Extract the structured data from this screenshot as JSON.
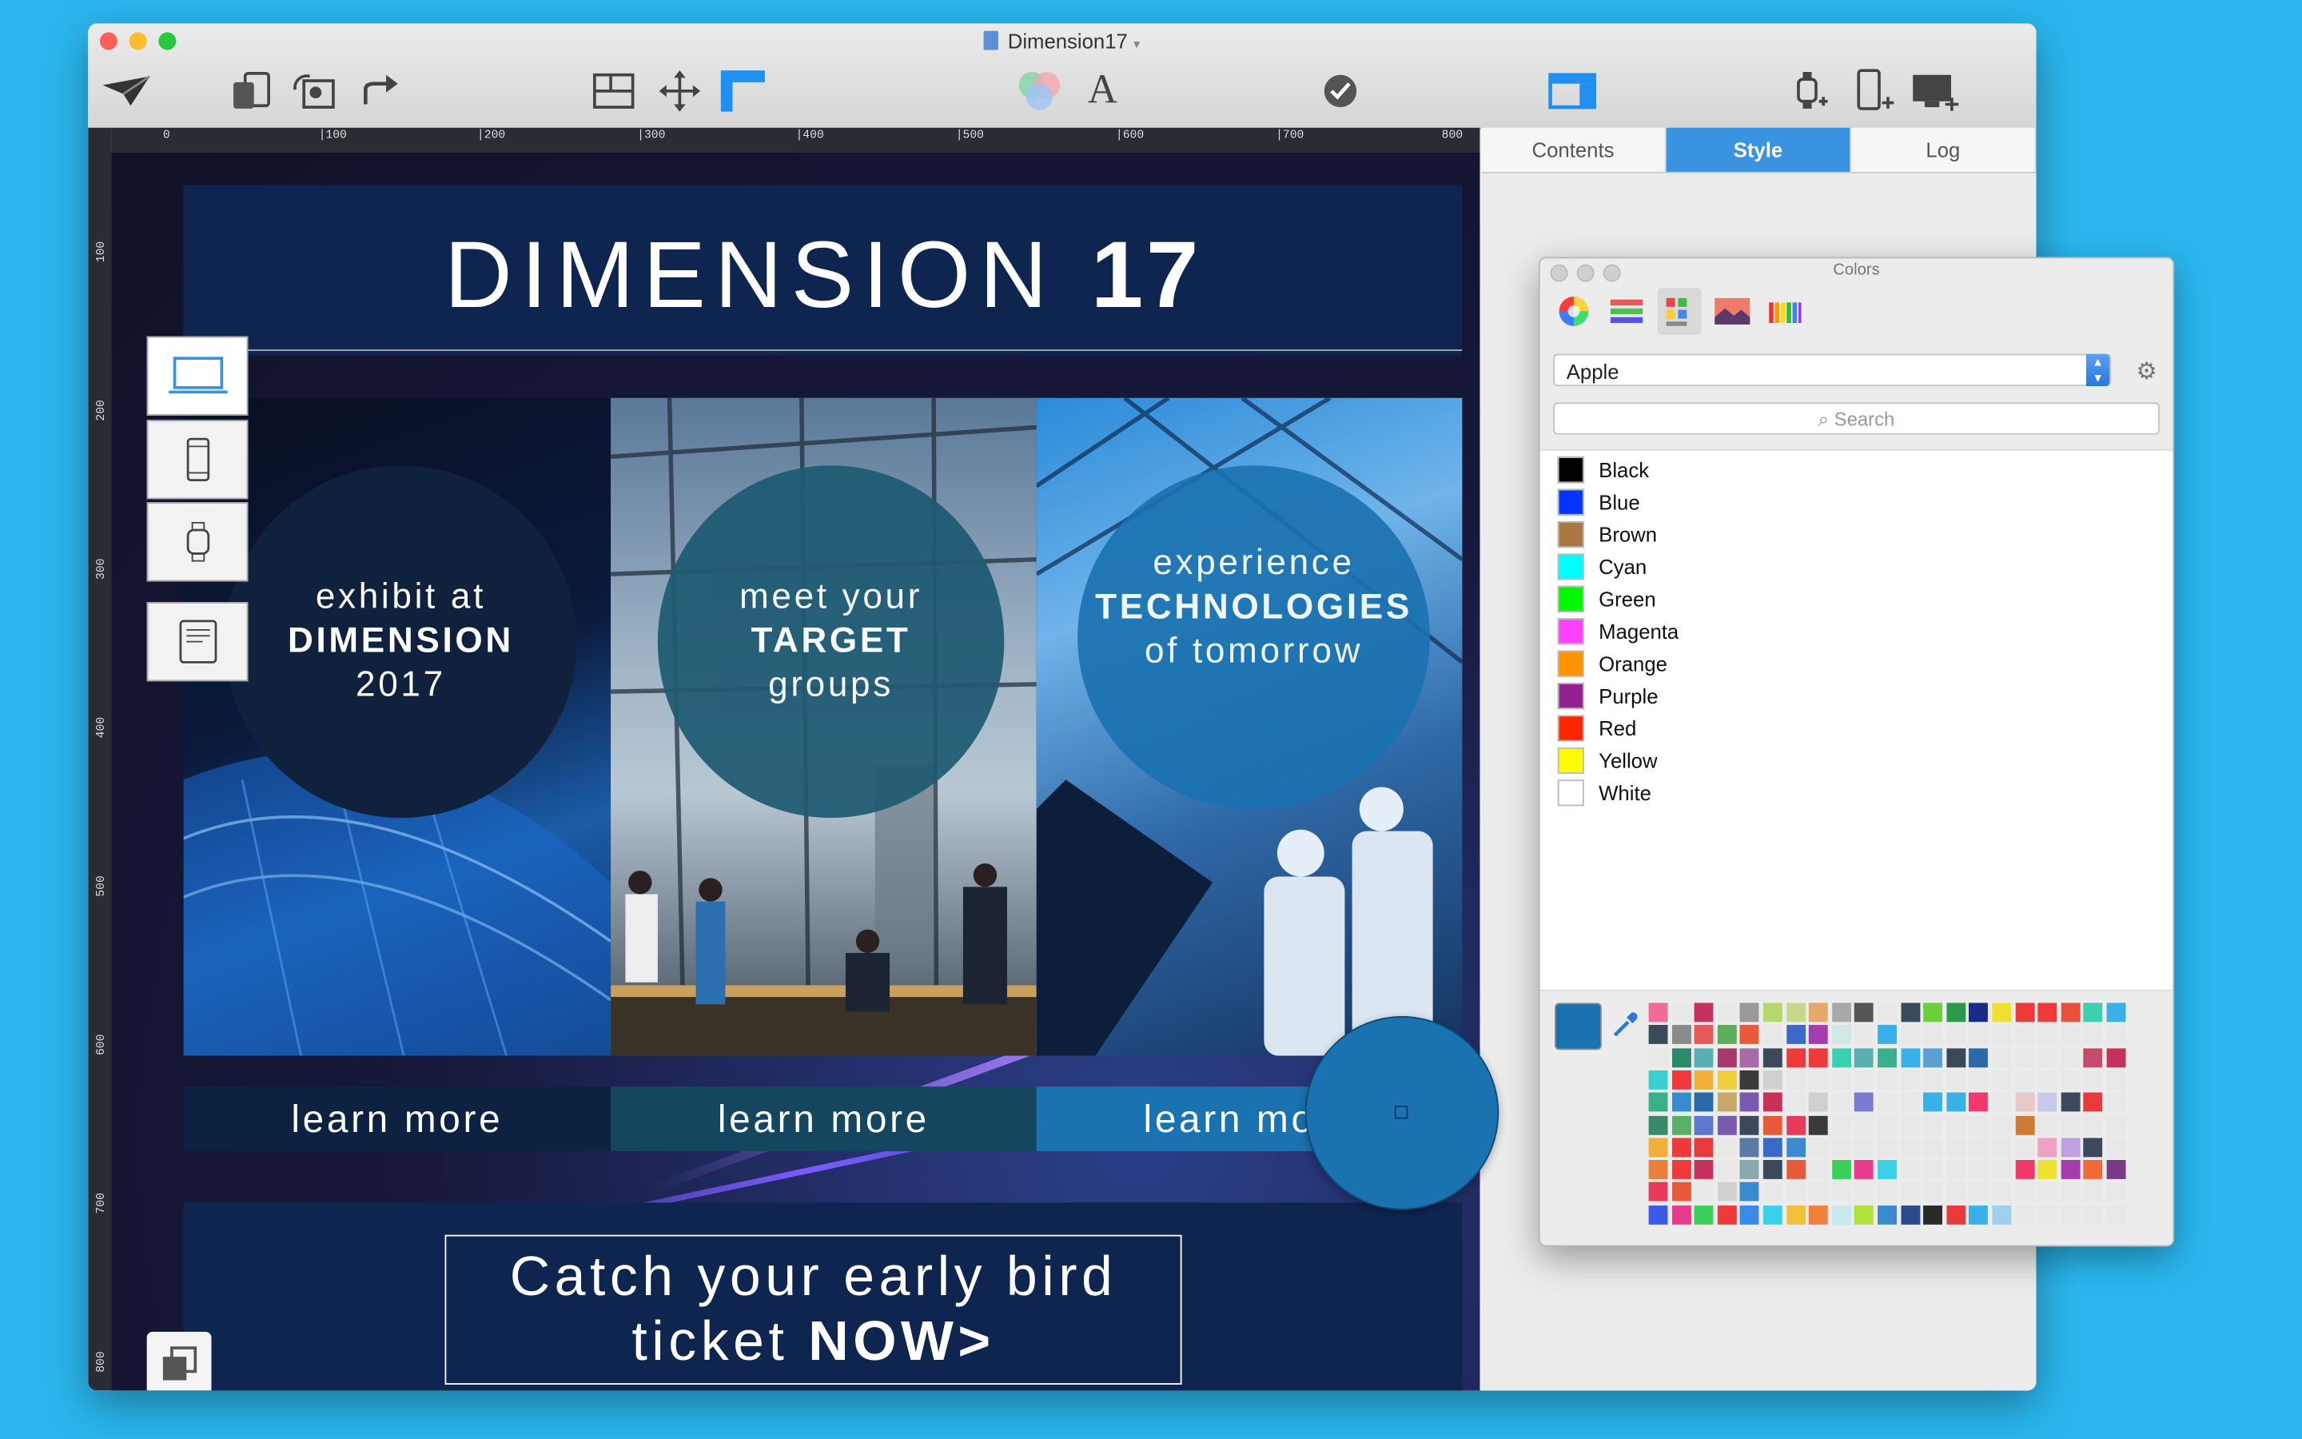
{
  "window": {
    "title": "Dimension17",
    "traffic_lights": {
      "close": "#fe5f57",
      "minimize": "#febc2e",
      "zoom": "#28c840"
    }
  },
  "toolbar": {
    "icons": [
      "publish-icon",
      "devices-icon",
      "photo-replace-icon",
      "share-icon",
      "layout-icon",
      "move-icon",
      "ruler-icon",
      "colors-icon",
      "fonts-icon",
      "check-icon",
      "window-toggle-icon",
      "add-watch-icon",
      "add-phone-icon",
      "add-desktop-icon"
    ]
  },
  "ruler": {
    "top_labels": [
      "0",
      "|100",
      "|200",
      "|300",
      "|400",
      "|500",
      "|600",
      "|700",
      "800"
    ],
    "left_labels": [
      "100",
      "200",
      "300",
      "400",
      "500",
      "600",
      "700",
      "800"
    ]
  },
  "device_buttons": [
    "laptop-icon",
    "phone-icon",
    "watch-icon",
    "printer-icon"
  ],
  "design": {
    "title_light": "DIMENSION",
    "title_bold": "17",
    "panels": [
      {
        "line1": "exhibit at",
        "line2": "DIMENSION",
        "line3": "2017",
        "button": "learn more"
      },
      {
        "line1": "meet your",
        "line2": "TARGET",
        "line3": "groups",
        "button": "learn more"
      },
      {
        "line1": "experience",
        "line2": "TECHNOLOGIES",
        "line3": "of tomorrow",
        "button": "learn more"
      }
    ],
    "cta_line1": "Catch your early bird",
    "cta_line2_light": "ticket",
    "cta_line2_bold": "NOW>"
  },
  "inspector": {
    "tabs": [
      "Contents",
      "Style",
      "Log"
    ],
    "active_tab": "Style",
    "accent": "#3a93e0"
  },
  "colors_panel": {
    "title": "Colors",
    "palette_name": "Apple",
    "search_placeholder": "Search",
    "current_color": "#1a72b0",
    "colors": [
      {
        "name": "Black",
        "hex": "#000000"
      },
      {
        "name": "Blue",
        "hex": "#0433ff"
      },
      {
        "name": "Brown",
        "hex": "#aa7942"
      },
      {
        "name": "Cyan",
        "hex": "#00fdff"
      },
      {
        "name": "Green",
        "hex": "#00f900"
      },
      {
        "name": "Magenta",
        "hex": "#ff40ff"
      },
      {
        "name": "Orange",
        "hex": "#ff9300"
      },
      {
        "name": "Purple",
        "hex": "#942192"
      },
      {
        "name": "Red",
        "hex": "#ff2600"
      },
      {
        "name": "Yellow",
        "hex": "#fffb00"
      },
      {
        "name": "White",
        "hex": "#ffffff"
      }
    ]
  }
}
